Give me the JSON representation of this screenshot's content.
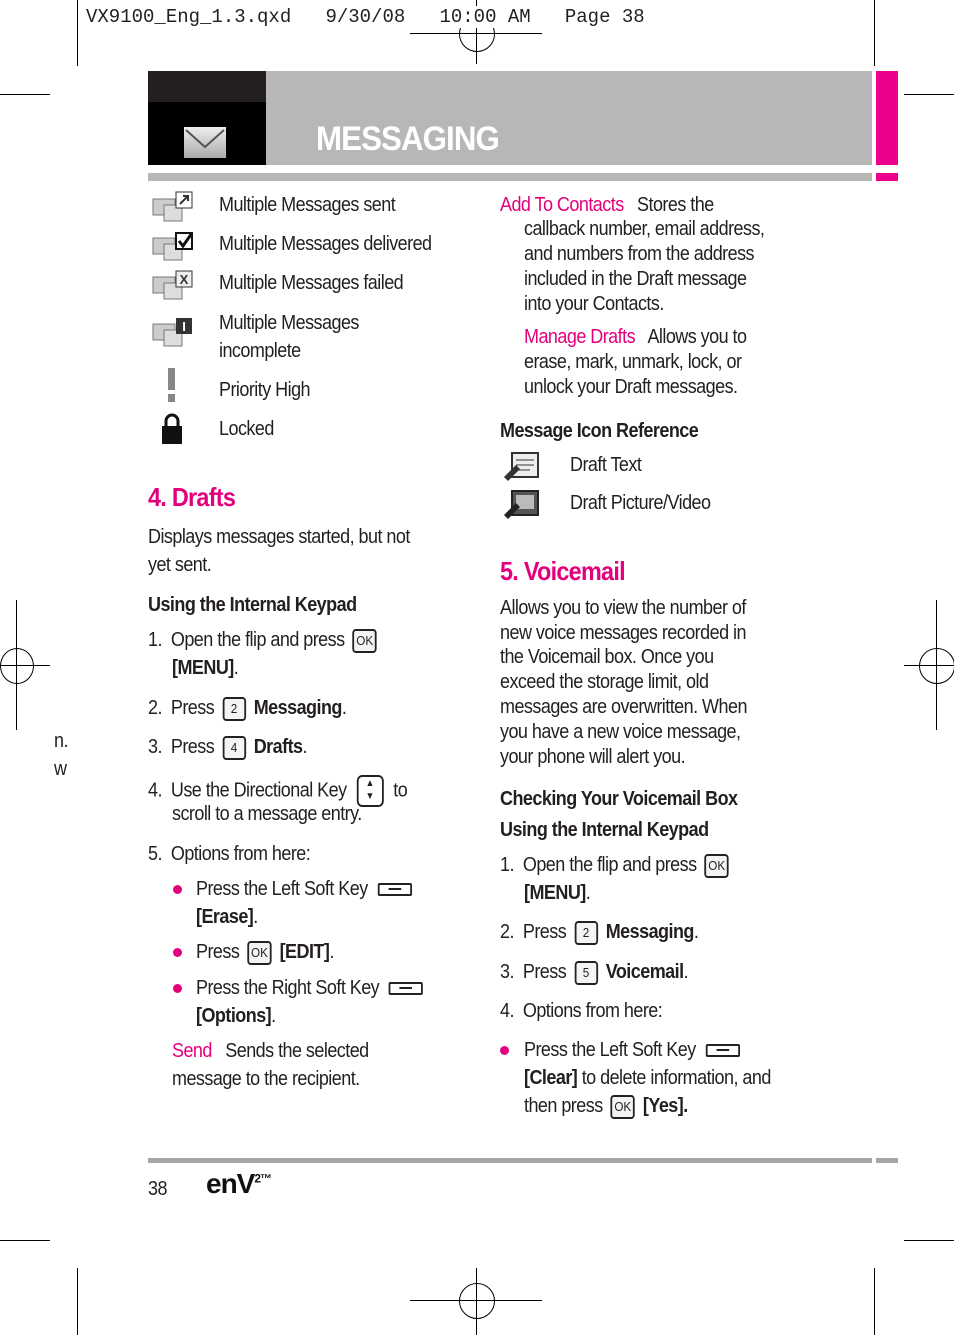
{
  "print_line": "VX9100_Eng_1.3.qxd   9/30/08   10:00 AM   Page 38",
  "colors": {
    "accent": "#e4007c",
    "header_gray": "#b8b7b8",
    "header_dark": "#000000"
  },
  "header": {
    "title": "MESSAGING",
    "icon": "envelope-icon"
  },
  "margin_text": [
    "n.",
    "w"
  ],
  "icon_list": [
    {
      "icon": "multiple-sent-icon",
      "label": "Multiple Messages sent"
    },
    {
      "icon": "multiple-delivered-icon",
      "label": "Multiple Messages delivered"
    },
    {
      "icon": "multiple-failed-icon",
      "label": "Multiple Messages failed"
    },
    {
      "icon": "multiple-incomplete-icon",
      "label": [
        "Multiple Messages",
        "incomplete"
      ]
    },
    {
      "icon": "priority-high-icon",
      "label": "Priority High"
    },
    {
      "icon": "lock-icon",
      "label": "Locked"
    }
  ],
  "drafts": {
    "heading": "4. Drafts",
    "description": [
      "Displays messages started, but not",
      "yet sent."
    ],
    "subheading": "Using the Internal Keypad",
    "step1": {
      "num": "1.",
      "text": "Open the flip and press",
      "key": "OK",
      "cont": "[MENU]",
      "end": "."
    },
    "step2": {
      "num": "2.",
      "text": "Press",
      "key": "2",
      "bold": "Messaging",
      "end": "."
    },
    "step3": {
      "num": "3.",
      "text": "Press",
      "key": "4",
      "bold": "Drafts",
      "end": "."
    },
    "step4": {
      "num": "4.",
      "text": "Use the Directional Key",
      "after": "to",
      "cont": "scroll to a message entry."
    },
    "step5": {
      "num": "5.",
      "text": "Options from here:"
    },
    "opt1": {
      "text": "Press the Left Soft Key",
      "cont": "[Erase]",
      "end": "."
    },
    "opt2": {
      "text": "Press",
      "key": "OK",
      "bold": "[EDIT]",
      "end": "."
    },
    "opt3": {
      "text": "Press the Right Soft Key",
      "cont": "[Options]",
      "end": "."
    },
    "send": {
      "term": "Send",
      "text": "Sends the selected",
      "cont": "message to the recipient."
    }
  },
  "right": {
    "add": {
      "term": "Add To Contacts",
      "lines": [
        "Stores the",
        "callback number, email address,",
        "and numbers from the address",
        "included in the Draft message",
        "into your Contacts."
      ]
    },
    "manage": {
      "term": "Manage Drafts",
      "lines": [
        "Allows you to",
        "erase, mark, unmark, lock, or",
        "unlock your Draft messages."
      ]
    },
    "ref_heading": "Message Icon Reference",
    "ref": [
      {
        "icon": "draft-text-icon",
        "label": "Draft Text"
      },
      {
        "icon": "draft-picture-video-icon",
        "label": "Draft Picture/Video"
      }
    ]
  },
  "voicemail": {
    "heading": "5. Voicemail",
    "description": [
      "Allows you to view the number of",
      "new voice messages recorded in",
      "the Voicemail box. Once you",
      "exceed the storage limit, old",
      "messages are overwritten. When",
      "you have a new voice message,",
      "your phone will alert you."
    ],
    "sub1": "Checking Your Voicemail Box",
    "sub2": "Using the Internal Keypad",
    "step1": {
      "num": "1.",
      "text": "Open the flip and press",
      "key": "OK",
      "cont": "[MENU]",
      "end": "."
    },
    "step2": {
      "num": "2.",
      "text": "Press",
      "key": "2",
      "bold": "Messaging",
      "end": "."
    },
    "step3": {
      "num": "3.",
      "text": "Press",
      "key": "5",
      "bold": "Voicemail",
      "end": "."
    },
    "step4": {
      "num": "4.",
      "text": "Options from here:"
    },
    "opt1": {
      "text": "Press the Left Soft Key",
      "bold": "[Clear]",
      "cont": "to delete information, and",
      "then": "then press",
      "key": "OK",
      "bold2": "[Yes]",
      "end": "."
    }
  },
  "footer": {
    "page": "38",
    "logo": "enV2"
  }
}
